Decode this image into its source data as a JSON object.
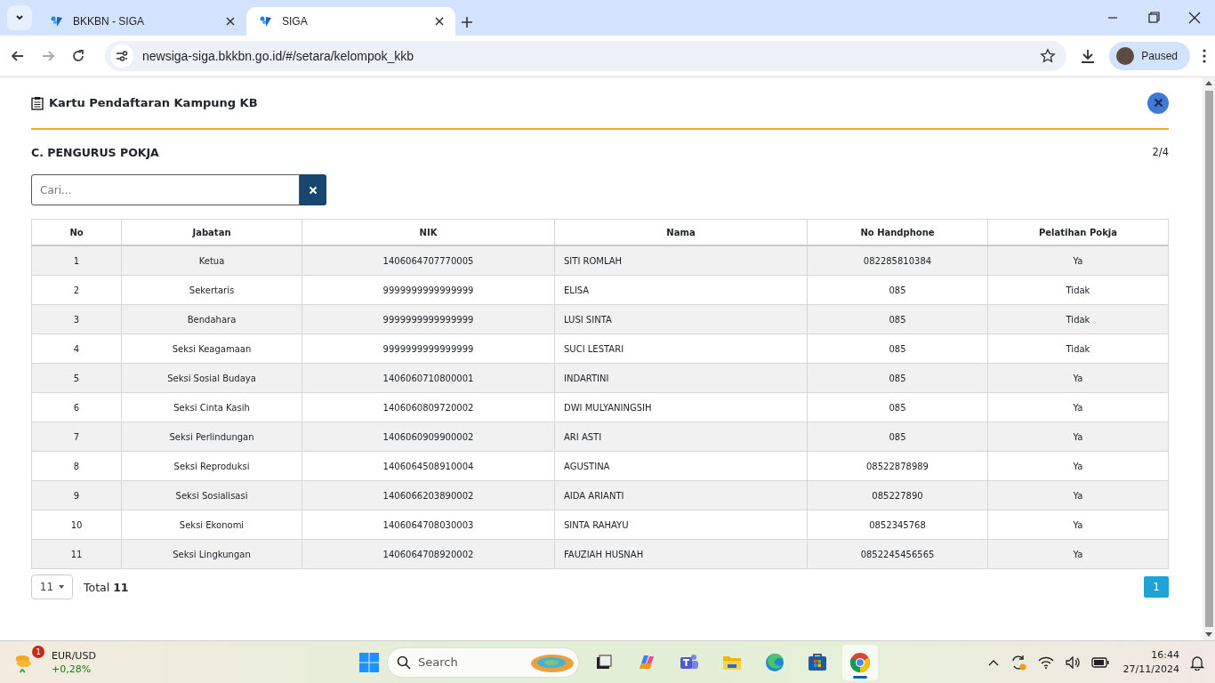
{
  "browser": {
    "tabs": [
      {
        "title": "BKKBN - SIGA",
        "selected": false
      },
      {
        "title": "SIGA",
        "selected": true
      }
    ],
    "address": "newsiga-siga.bkkbn.go.id/#/setara/kelompok_kkb",
    "profile_label": "Paused"
  },
  "modal": {
    "title": "Kartu Pendaftaran Kampung KB",
    "section_title": "C. PENGURUS POKJA",
    "step": "2/4",
    "search": {
      "placeholder": "Cari..."
    },
    "table": {
      "columns": [
        "No",
        "Jabatan",
        "NIK",
        "Nama",
        "No Handphone",
        "Pelatihan Pokja"
      ],
      "rows": [
        [
          "1",
          "Ketua",
          "1406064707770005",
          "SITI ROMLAH",
          "082285810384",
          "Ya"
        ],
        [
          "2",
          "Sekertaris",
          "9999999999999999",
          "ELISA",
          "085",
          "Tidak"
        ],
        [
          "3",
          "Bendahara",
          "9999999999999999",
          "LUSI SINTA",
          "085",
          "Tidak"
        ],
        [
          "4",
          "Seksi Keagamaan",
          "9999999999999999",
          "SUCI LESTARI",
          "085",
          "Tidak"
        ],
        [
          "5",
          "Seksi Sosial Budaya",
          "1406060710800001",
          "INDARTINI",
          "085",
          "Ya"
        ],
        [
          "6",
          "Seksi Cinta Kasih",
          "1406060809720002",
          "DWI MULYANINGSIH",
          "085",
          "Ya"
        ],
        [
          "7",
          "Seksi Perlindungan",
          "1406060909900002",
          "ARI ASTI",
          "085",
          "Ya"
        ],
        [
          "8",
          "Seksi Reproduksi",
          "1406064508910004",
          "AGUSTINA",
          "08522878989",
          "Ya"
        ],
        [
          "9",
          "Seksi Sosialisasi",
          "1406066203890002",
          "AIDA ARIANTI",
          "085227890",
          "Ya"
        ],
        [
          "10",
          "Seksi Ekonomi",
          "1406064708030003",
          "SINTA RAHAYU",
          "0852345768",
          "Ya"
        ],
        [
          "11",
          "Seksi Lingkungan",
          "1406064708920002",
          "FAUZIAH HUSNAH",
          "0852245456565",
          "Ya"
        ]
      ]
    },
    "page_size": "11",
    "total": "Total **11**",
    "pages": [
      {
        "label": "1",
        "selected": true
      }
    ]
  },
  "taskbar": {
    "widget": {
      "badge": "1",
      "name": "EUR/USD",
      "change": "+0,28%"
    },
    "search": {
      "placeholder": "Search"
    },
    "apps": [
      {
        "kind": "taskview",
        "selected": false
      },
      {
        "kind": "copilot",
        "selected": false
      },
      {
        "kind": "teams",
        "selected": false
      },
      {
        "kind": "files",
        "selected": false
      },
      {
        "kind": "edge",
        "selected": false
      },
      {
        "kind": "store",
        "selected": false
      },
      {
        "kind": "chrome",
        "selected": true
      }
    ],
    "time": "16:44",
    "date": "27/11/2024"
  }
}
